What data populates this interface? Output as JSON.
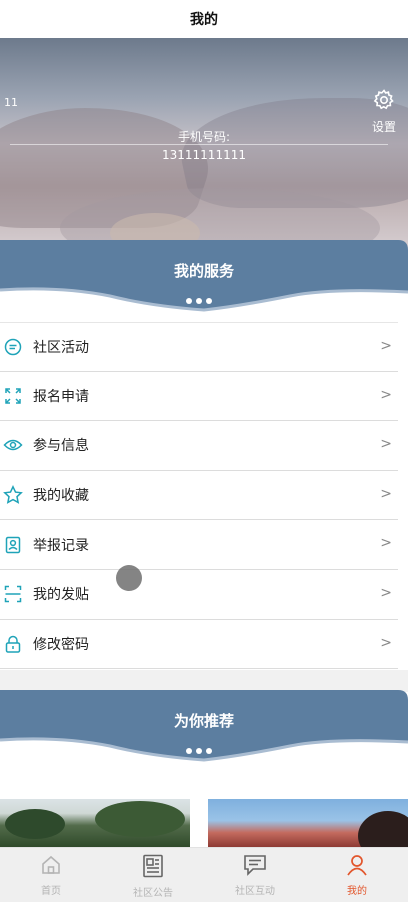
{
  "header": {
    "title": "我的"
  },
  "profile": {
    "username": "11",
    "settings_label": "设置",
    "phone_label": "手机号码:",
    "phone_value": "13111111111"
  },
  "services": {
    "title": "我的服务",
    "items": [
      {
        "label": "社区活动",
        "icon": "chat-bubble-icon"
      },
      {
        "label": "报名申请",
        "icon": "expand-arrows-icon"
      },
      {
        "label": "参与信息",
        "icon": "eye-icon"
      },
      {
        "label": "我的收藏",
        "icon": "star-icon"
      },
      {
        "label": "举报记录",
        "icon": "report-icon"
      },
      {
        "label": "我的发贴",
        "icon": "scan-frame-icon"
      },
      {
        "label": "修改密码",
        "icon": "lock-icon"
      }
    ],
    "chevron": ">"
  },
  "recommend": {
    "title": "为你推荐"
  },
  "tabbar": {
    "tabs": [
      {
        "label": "首页",
        "icon": "home-icon",
        "active": false
      },
      {
        "label": "社区公告",
        "icon": "newspaper-icon",
        "active": false
      },
      {
        "label": "社区互动",
        "icon": "message-icon",
        "active": false
      },
      {
        "label": "我的",
        "icon": "person-icon",
        "active": true
      }
    ]
  },
  "colors": {
    "band": "#5c7ea0",
    "icon_teal": "#1fa3b8",
    "tab_active": "#e2562c",
    "tab_inactive": "#b4b4b4"
  }
}
